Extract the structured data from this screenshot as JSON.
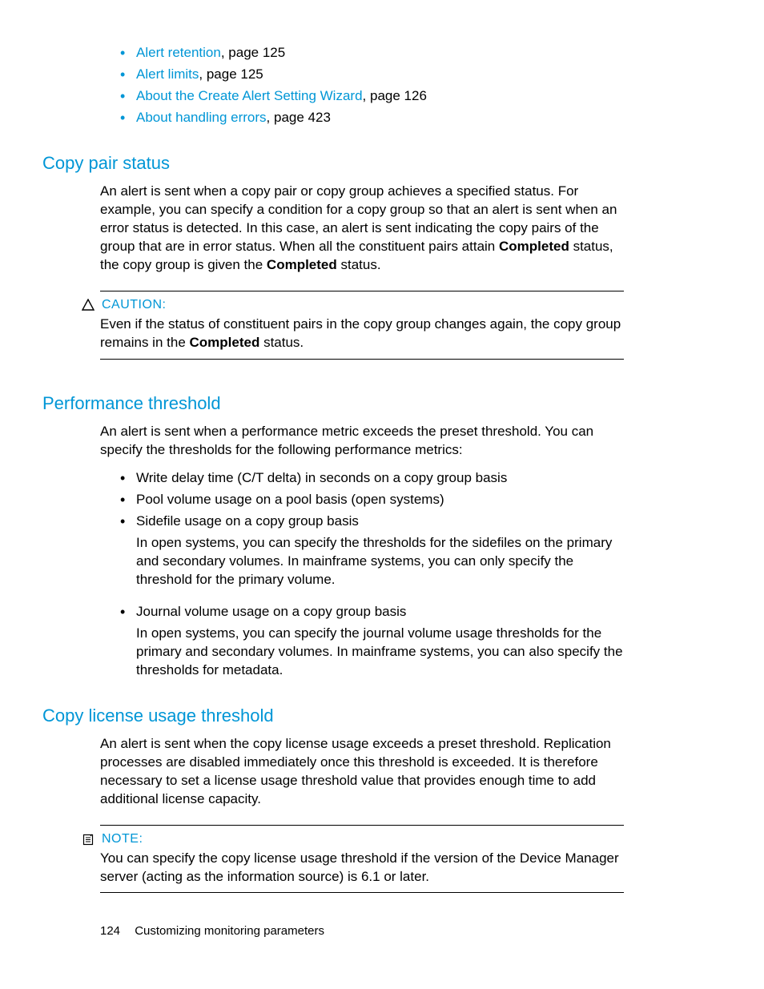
{
  "xrefs": [
    {
      "label": "Alert retention",
      "suffix": ", page 125"
    },
    {
      "label": "Alert limits",
      "suffix": ", page 125"
    },
    {
      "label": "About the Create Alert Setting Wizard",
      "suffix": ", page 126"
    },
    {
      "label": "About handling errors",
      "suffix": ", page 423"
    }
  ],
  "sec1": {
    "heading": "Copy pair status",
    "p1a": "An alert is sent when a copy pair or copy group achieves a specified status. For example, you can specify a condition for a copy group so that an alert is sent when an error status is detected. In this case, an alert is sent indicating the copy pairs of the group that are in error status. When all the constituent pairs attain ",
    "p1b": "Completed",
    "p1c": " status, the copy group is given the ",
    "p1d": "Completed",
    "p1e": " status.",
    "caution_label": "CAUTION:",
    "caution_a": "Even if the status of constituent pairs in the copy group changes again, the copy group remains in the ",
    "caution_b": "Completed",
    "caution_c": " status."
  },
  "sec2": {
    "heading": "Performance threshold",
    "intro": "An alert is sent when a performance metric exceeds the preset threshold. You can specify the thresholds for the following performance metrics:",
    "b1": "Write delay time (C/T delta) in seconds on a copy group basis",
    "b2": "Pool volume usage on a pool basis (open systems)",
    "b3": "Sidefile usage on a copy group basis",
    "b3sub": "In open systems, you can specify the thresholds for the sidefiles on the primary and secondary volumes. In mainframe systems, you can only specify the threshold for the primary volume.",
    "b4": "Journal volume usage on a copy group basis",
    "b4sub": "In open systems, you can specify the journal volume usage thresholds for the primary and secondary volumes. In mainframe systems, you can also specify the thresholds for metadata."
  },
  "sec3": {
    "heading": "Copy license usage threshold",
    "p": "An alert is sent when the copy license usage exceeds a preset threshold. Replication processes are disabled immediately once this threshold is exceeded. It is therefore necessary to set a license usage threshold value that provides enough time to add additional license capacity.",
    "note_label": "NOTE:",
    "note_body": "You can specify the copy license usage threshold if the version of the Device Manager server (acting as the information source) is 6.1 or later."
  },
  "footer": {
    "page": "124",
    "title": "Customizing monitoring parameters"
  }
}
